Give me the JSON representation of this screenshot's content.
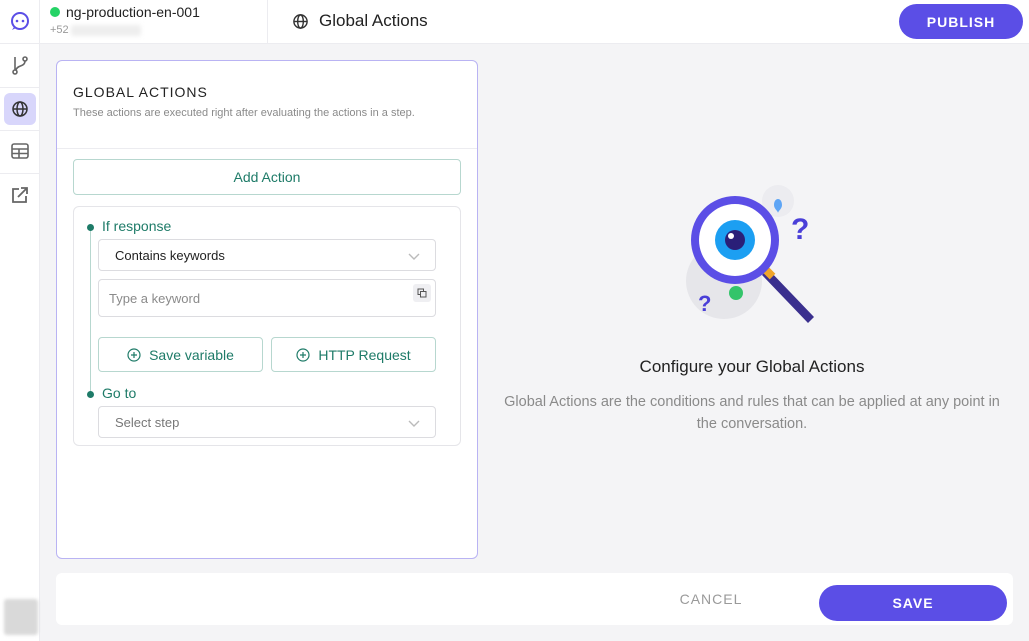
{
  "sidebar": {
    "items": [
      {
        "icon": "bot-logo-icon"
      },
      {
        "icon": "flow-branch-icon"
      },
      {
        "icon": "globe-icon",
        "active": true
      },
      {
        "icon": "table-icon"
      },
      {
        "icon": "external-link-icon"
      }
    ]
  },
  "header": {
    "bot_name": "ng-production-en-001",
    "bot_phone": "+52",
    "page_title": "Global Actions",
    "publish_label": "PUBLISH"
  },
  "panel": {
    "title": "GLOBAL ACTIONS",
    "subtitle": "These actions are executed right after evaluating the actions in a step.",
    "add_action_label": "Add Action",
    "if_response_label": "If response",
    "condition_value": "Contains keywords",
    "keyword_placeholder": "Type a keyword",
    "save_variable_label": "Save variable",
    "http_request_label": "HTTP Request",
    "goto_label": "Go to",
    "step_placeholder": "Select step"
  },
  "empty_state": {
    "title": "Configure your Global Actions",
    "description": "Global Actions are the conditions and rules that can be applied at any point in the conversation."
  },
  "footer": {
    "cancel_label": "CANCEL",
    "save_label": "SAVE"
  },
  "colors": {
    "accent": "#5b4ee6",
    "teal": "#1e7b68",
    "whatsapp": "#25d366"
  }
}
